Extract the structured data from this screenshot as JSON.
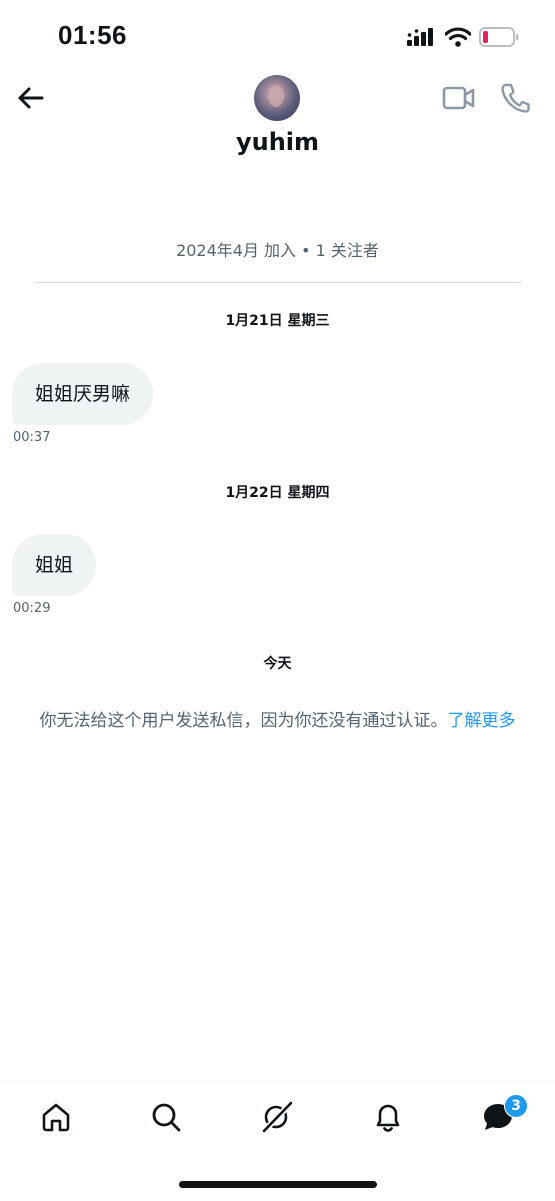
{
  "status_bar": {
    "time": "01:56"
  },
  "header": {
    "display_name": "yuhim"
  },
  "profile": {
    "joined_text": "2024年4月 加入 • 1 关注者"
  },
  "conversation": {
    "day1": {
      "date": "1月21日 星期三",
      "message": "姐姐厌男嘛",
      "time": "00:37"
    },
    "day2": {
      "date": "1月22日 星期四",
      "message": "姐姐",
      "time": "00:29"
    },
    "today_label": "今天",
    "notice_text": "你无法给这个用户发送私信，因为你还没有通过认证。",
    "learn_more": "了解更多"
  },
  "bottom_nav": {
    "messages_badge": "3"
  },
  "colors": {
    "accent": "#1d9bf0",
    "bubble": "#eff3f4",
    "muted_text": "#536471",
    "battery_low": "#e0245e"
  }
}
